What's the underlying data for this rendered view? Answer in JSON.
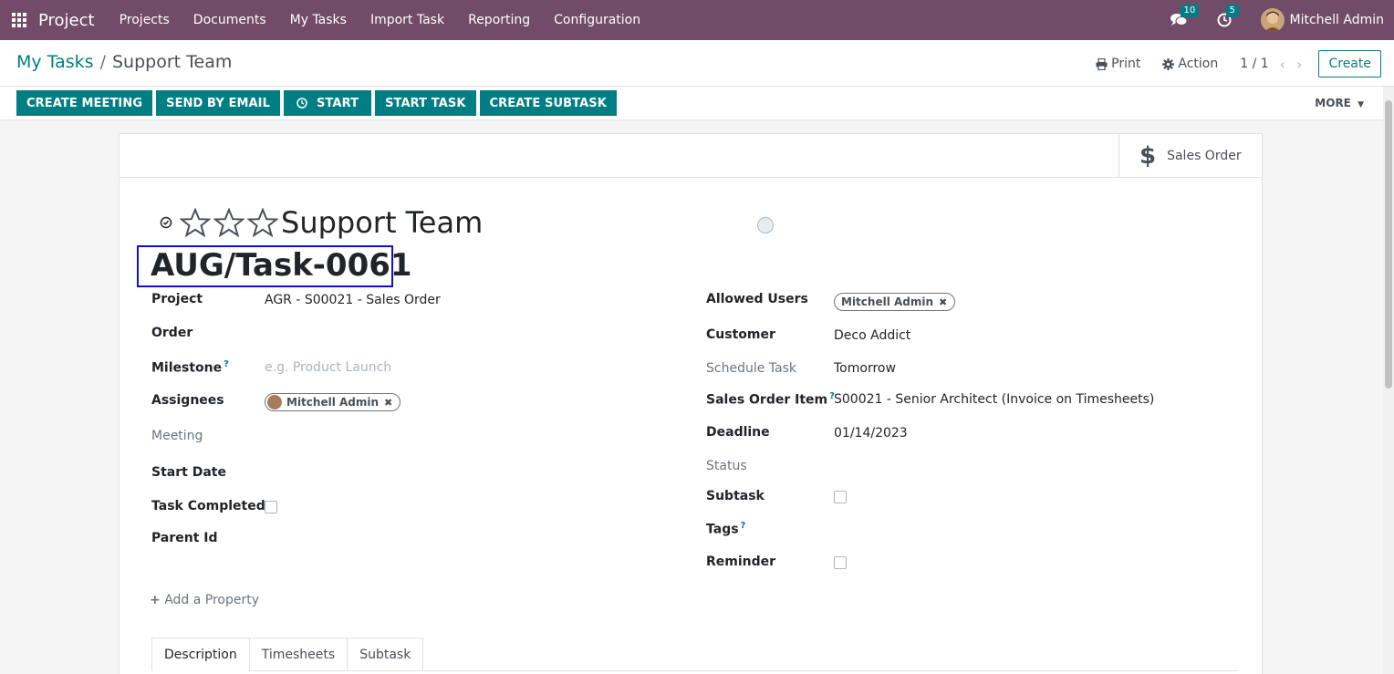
{
  "navbar": {
    "brand": "Project",
    "menu": [
      "Projects",
      "Documents",
      "My Tasks",
      "Import Task",
      "Reporting",
      "Configuration"
    ],
    "messages_count": "10",
    "activities_count": "5",
    "user": "Mitchell Admin"
  },
  "breadcrumb": {
    "parent": "My Tasks",
    "separator": "/",
    "current": "Support Team"
  },
  "control": {
    "print": "Print",
    "action": "Action",
    "pager": "1 / 1",
    "create": "Create"
  },
  "statusbar": {
    "buttons": [
      "CREATE MEETING",
      "SEND BY EMAIL",
      "START",
      "START TASK",
      "CREATE SUBTASK"
    ],
    "more": "MORE"
  },
  "smart_button": {
    "label": "Sales Order"
  },
  "form": {
    "title": "Support Team",
    "task_ref": "AUG/Task-0061",
    "left_fields": {
      "project_label": "Project",
      "project_value": "AGR - S00021 - Sales Order",
      "order_label": "Order",
      "milestone_label": "Milestone",
      "milestone_placeholder": "e.g. Product Launch",
      "assignees_label": "Assignees",
      "assignee_tag": "Mitchell Admin",
      "meeting_label": "Meeting",
      "start_date_label": "Start Date",
      "task_completed_label": "Task Completed",
      "parent_id_label": "Parent Id"
    },
    "right_fields": {
      "allowed_users_label": "Allowed Users",
      "allowed_user_tag": "Mitchell Admin",
      "customer_label": "Customer",
      "customer_value": "Deco Addict",
      "schedule_task_label": "Schedule Task",
      "schedule_task_value": "Tomorrow",
      "sales_order_item_label": "Sales Order Item",
      "sales_order_item_value": "S00021 - Senior Architect (Invoice on Timesheets)",
      "deadline_label": "Deadline",
      "deadline_value": "01/14/2023",
      "status_label": "Status",
      "subtask_label": "Subtask",
      "tags_label": "Tags",
      "reminder_label": "Reminder"
    },
    "help_marker": "?",
    "add_property": "Add a Property",
    "tabs": [
      "Description",
      "Timesheets",
      "Subtask"
    ]
  },
  "colors": {
    "navbar": "#714b67",
    "primary": "#017e84",
    "highlight_box": "#1010d0"
  }
}
